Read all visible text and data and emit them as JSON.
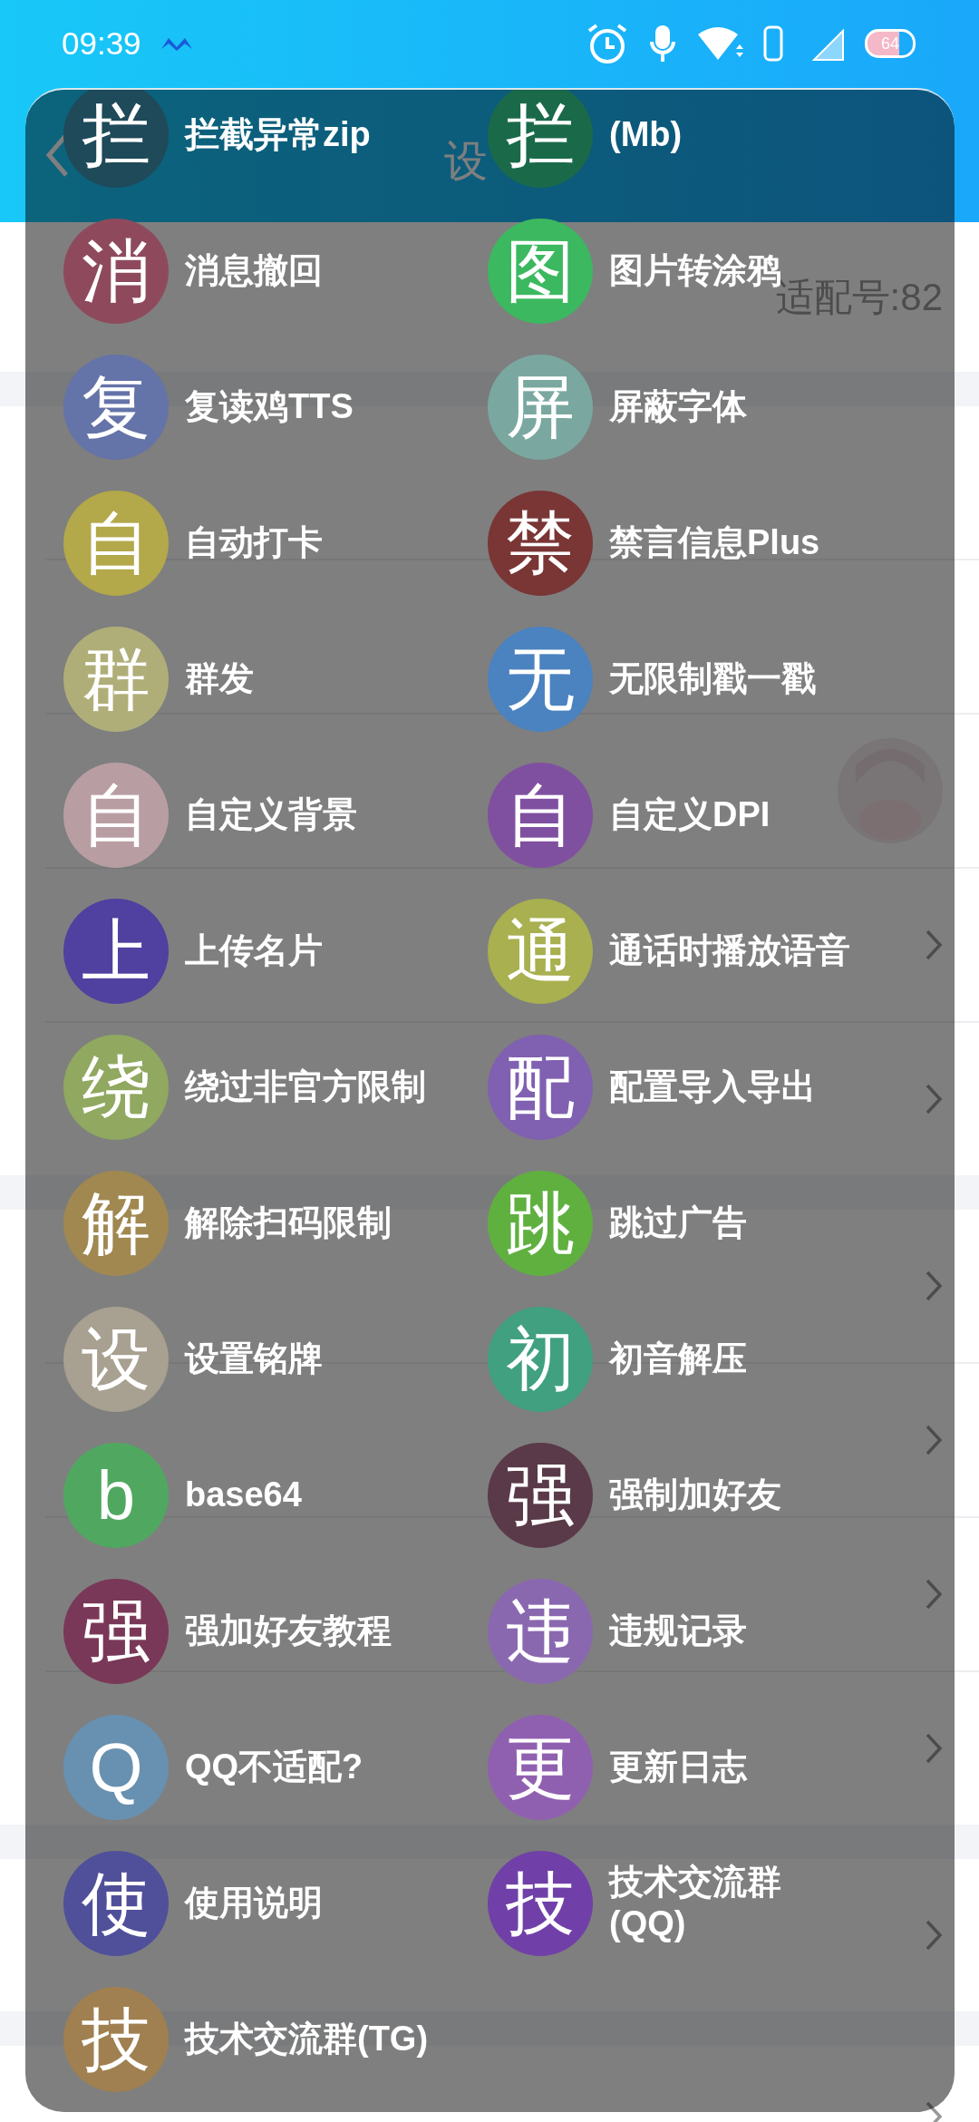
{
  "status_bar": {
    "time": "09:39",
    "battery": "64"
  },
  "header": {
    "title": "设"
  },
  "settings": {
    "sections": [
      {
        "rows": [
          {
            "kind": "profile",
            "value": "适配号:82",
            "chevron": false
          }
        ]
      },
      {
        "rows": [
          {
            "kind": "plain",
            "chevron": false
          },
          {
            "kind": "plain",
            "chevron": false
          },
          {
            "kind": "avatar",
            "chevron": false
          },
          {
            "kind": "plain",
            "chevron": true
          },
          {
            "kind": "plain",
            "chevron": true
          }
        ]
      },
      {
        "rows": [
          {
            "kind": "plain",
            "chevron": true
          },
          {
            "kind": "plain",
            "chevron": true
          },
          {
            "kind": "plain",
            "chevron": true
          },
          {
            "kind": "plain",
            "chevron": true
          }
        ]
      },
      {
        "rows": [
          {
            "kind": "plain",
            "chevron": true
          }
        ]
      },
      {
        "rows": [
          {
            "kind": "plain",
            "chevron": true
          }
        ]
      }
    ]
  },
  "features": [
    {
      "letter": "拦",
      "label": "拦截异常zip",
      "color": "#1e4a5a"
    },
    {
      "letter": "拦",
      "label": "(Mb)",
      "color": "#1a6a4a"
    },
    {
      "letter": "消",
      "label": "消息撤回",
      "color": "#8e4a5c"
    },
    {
      "letter": "图",
      "label": "图片转涂鸦",
      "color": "#3cb860"
    },
    {
      "letter": "复",
      "label": "复读鸡TTS",
      "color": "#6473a8"
    },
    {
      "letter": "屏",
      "label": "屏蔽字体",
      "color": "#7aa8a0"
    },
    {
      "letter": "自",
      "label": "自动打卡",
      "color": "#b3a84a"
    },
    {
      "letter": "禁",
      "label": "禁言信息Plus",
      "color": "#7a3535"
    },
    {
      "letter": "群",
      "label": "群发",
      "color": "#b0ae78"
    },
    {
      "letter": "无",
      "label": "无限制戳一戳",
      "color": "#4b82c0"
    },
    {
      "letter": "自",
      "label": "自定义背景",
      "color": "#b89ea2"
    },
    {
      "letter": "自",
      "label": "自定义DPI",
      "color": "#8050a0"
    },
    {
      "letter": "上",
      "label": "上传名片",
      "color": "#5040a0"
    },
    {
      "letter": "通",
      "label": "通话时播放语音",
      "color": "#a8b050"
    },
    {
      "letter": "绕",
      "label": "绕过非官方限制",
      "color": "#90a860"
    },
    {
      "letter": "配",
      "label": "配置导入导出",
      "color": "#8060b0"
    },
    {
      "letter": "解",
      "label": "解除扫码限制",
      "color": "#a08850"
    },
    {
      "letter": "跳",
      "label": "跳过广告",
      "color": "#60b040"
    },
    {
      "letter": "设",
      "label": "设置铭牌",
      "color": "#a8a090"
    },
    {
      "letter": "初",
      "label": "初音解压",
      "color": "#40a080"
    },
    {
      "letter": "b",
      "label": "base64",
      "color": "#50a860"
    },
    {
      "letter": "强",
      "label": "强制加好友",
      "color": "#5a3a48"
    },
    {
      "letter": "强",
      "label": "强加好友教程",
      "color": "#7a3858"
    },
    {
      "letter": "违",
      "label": "违规记录",
      "color": "#8a68b0"
    },
    {
      "letter": "Q",
      "label": "QQ不适配?",
      "color": "#6890b0"
    },
    {
      "letter": "更",
      "label": "更新日志",
      "color": "#9060b0"
    },
    {
      "letter": "使",
      "label": "使用说明",
      "color": "#50509a"
    },
    {
      "letter": "技",
      "label": "技术交流群(QQ)",
      "color": "#7040a8"
    },
    {
      "letter": "技",
      "label": "技术交流群(TG)",
      "color": "#a08050"
    }
  ]
}
